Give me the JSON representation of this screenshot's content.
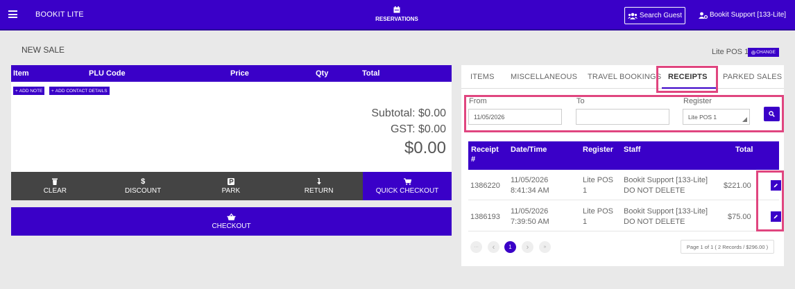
{
  "topbar": {
    "brand": "BOOKIT LITE",
    "reservations": "RESERVATIONS",
    "search_guest": "Search Guest",
    "user": "Bookit Support [133-Lite]"
  },
  "page": {
    "title": "NEW SALE",
    "register_name": "Lite POS 1",
    "change_label": "CHANGE"
  },
  "cart": {
    "columns": [
      "Item",
      "PLU Code",
      "Price",
      "Qty",
      "Total"
    ],
    "add_note": "ADD NOTE",
    "add_contact": "ADD CONTACT DETAILS",
    "subtotal": "Subtotal: $0.00",
    "gst": "GST: $0.00",
    "total": "$0.00",
    "actions": [
      "CLEAR",
      "DISCOUNT",
      "PARK",
      "RETURN",
      "QUICK CHECKOUT"
    ],
    "checkout": "CHECKOUT"
  },
  "tabs": {
    "items": "ITEMS",
    "misc": "MISCELLANEOUS",
    "travel": "TRAVEL BOOKINGS",
    "receipts": "RECEIPTS",
    "parked": "PARKED SALES"
  },
  "filters": {
    "from_label": "From",
    "from_value": "11/05/2026",
    "to_label": "To",
    "to_value": "",
    "register_label": "Register",
    "register_value": "Lite POS 1"
  },
  "receipts": {
    "columns": [
      "Receipt #",
      "Date/Time",
      "Register",
      "Staff",
      "Total"
    ],
    "rows": [
      {
        "receipt": "1386220",
        "date": "11/05/2026",
        "time": "8:41:34 AM",
        "reg_line1": "Lite POS",
        "reg_line2": "1",
        "staff_line1": "Bookit Support [133-Lite]",
        "staff_line2": "DO NOT DELETE",
        "total": "$221.00"
      },
      {
        "receipt": "1386193",
        "date": "11/05/2026",
        "time": "7:39:50 AM",
        "reg_line1": "Lite POS",
        "reg_line2": "1",
        "staff_line1": "Bookit Support [133-Lite]",
        "staff_line2": "DO NOT DELETE",
        "total": "$75.00"
      }
    ]
  },
  "pagination": {
    "first": "···",
    "prev": "‹",
    "current": "1",
    "next": "›",
    "last": "»",
    "info": "Page 1 of 1 ( 2 Records / $296.00 )"
  },
  "colors": {
    "brand": "#3a00c8",
    "action_dark": "#444444",
    "highlight": "#e0457f"
  },
  "icons": [
    "menu-icon",
    "calendar-icon",
    "users-icon",
    "user-gear-icon",
    "gear-icon",
    "plus-icon",
    "trash-icon",
    "dollar-icon",
    "parking-icon",
    "return-icon",
    "cart-icon",
    "basket-icon",
    "search-icon",
    "edit-icon"
  ]
}
